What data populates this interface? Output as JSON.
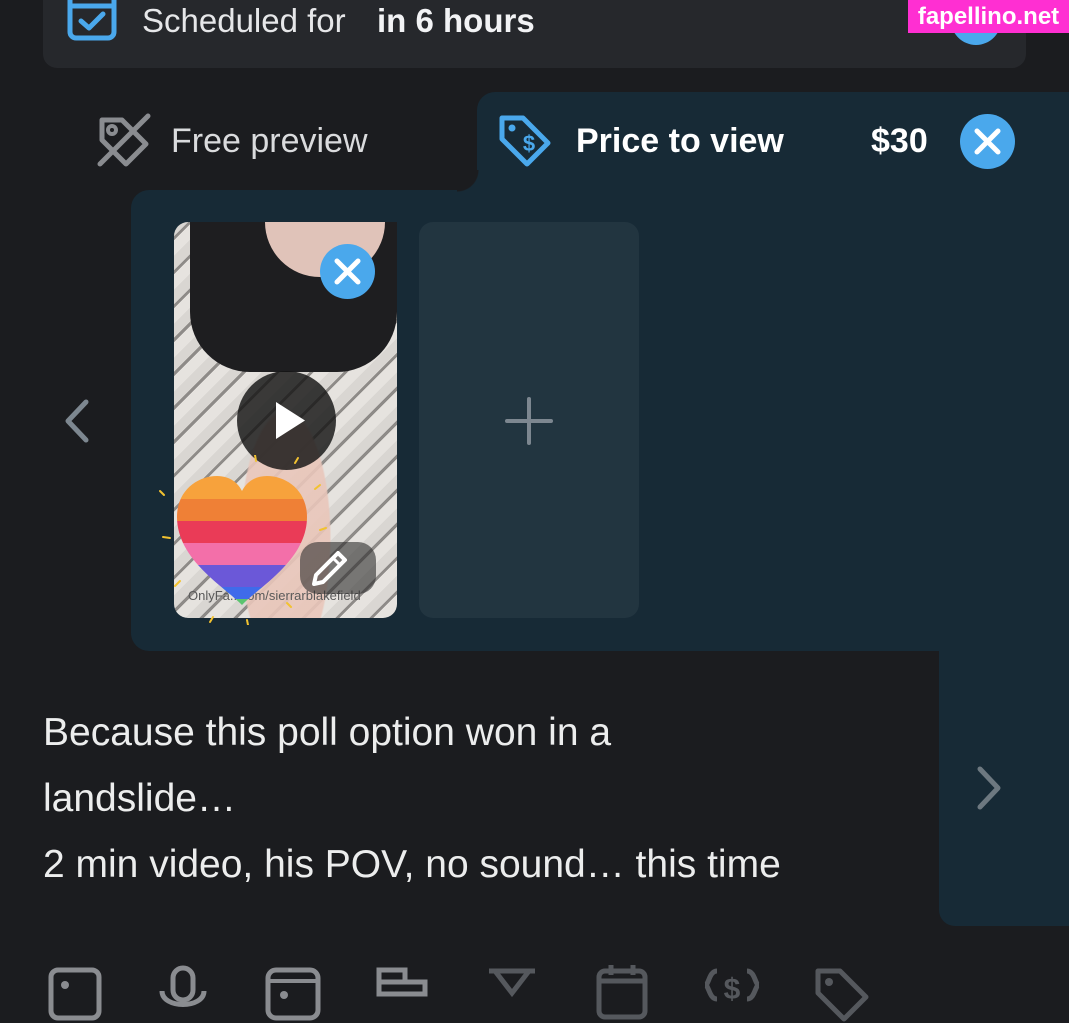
{
  "schedule": {
    "label": "Scheduled for",
    "value": "in 6 hours"
  },
  "watermark": "fapellino.net",
  "tabs": {
    "free_preview_label": "Free preview",
    "price_to_view_label": "Price to view",
    "price_value": "$30"
  },
  "media": {
    "credit": "OnlyFa...com/sierrarblakefield"
  },
  "caption": {
    "lines": [
      "Because this poll option won in a",
      "landslide…",
      "2 min video, his POV, no sound… this time"
    ]
  },
  "icons": {
    "schedule": "calendar-check-icon",
    "free_preview": "tag-off-icon",
    "price": "tag-dollar-icon",
    "remove": "close-icon",
    "play": "play-icon",
    "edit": "pencil-icon",
    "add": "plus-icon",
    "prev": "chevron-left-icon",
    "next": "chevron-right-icon",
    "toolbar": [
      "image-icon",
      "microphone-icon",
      "vault-icon",
      "poll-icon",
      "hourglass-icon",
      "calendar-icon",
      "price-icon",
      "tag-icon"
    ]
  },
  "colors": {
    "accent": "#4aa8ec",
    "panel": "#172a36",
    "background": "#1b1c1f",
    "watermark_bg": "#ff2fd2"
  }
}
